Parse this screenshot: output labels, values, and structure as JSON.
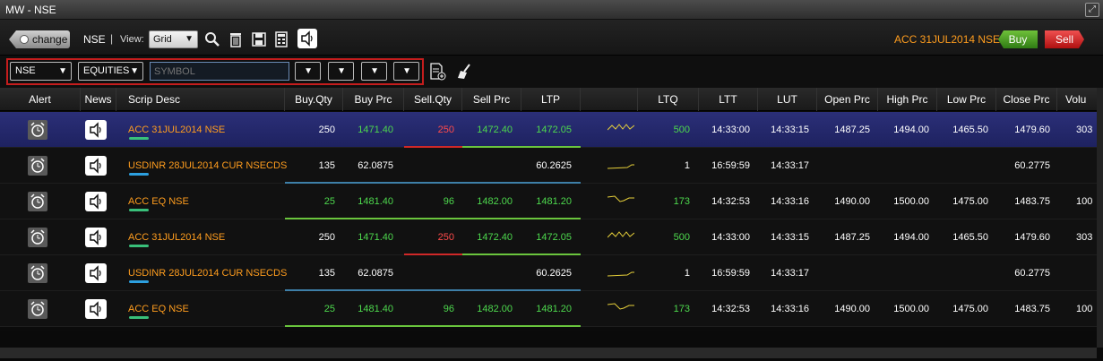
{
  "window": {
    "title": "MW - NSE"
  },
  "toolbar": {
    "change_label": "change",
    "exchange": "NSE",
    "separator": "|",
    "view_label": "View:",
    "view_value": "Grid",
    "selected_scrip": "ACC 31JUL2014 NSE",
    "buy_label": "Buy",
    "sell_label": "Sell"
  },
  "filters": {
    "exchange": "NSE",
    "segment": "EQUITIES",
    "symbol_placeholder": "SYMBOL"
  },
  "columns": [
    "Alert",
    "News",
    "Scrip Desc",
    "Buy.Qty",
    "Buy Prc",
    "Sell.Qty",
    "Sell Prc",
    "LTP",
    "",
    "LTQ",
    "LTT",
    "LUT",
    "Open Prc",
    "High Prc",
    "Low Prc",
    "Close Prc",
    "Volu"
  ],
  "rows": [
    {
      "scrip": "ACC 31JUL2014 NSE",
      "buy_qty": "250",
      "buy_prc": "1471.40",
      "sell_qty": "250",
      "sell_prc": "1472.40",
      "ltp": "1472.05",
      "ltq": "500",
      "ltt": "14:33:00",
      "lut": "14:33:15",
      "open": "1487.25",
      "high": "1494.00",
      "low": "1465.50",
      "close": "1479.60",
      "vol": "303"
    },
    {
      "scrip": "USDINR 28JUL2014 CUR NSECDS",
      "buy_qty": "135",
      "buy_prc": "62.0875",
      "sell_qty": "",
      "sell_prc": "",
      "ltp": "60.2625",
      "ltq": "1",
      "ltt": "16:59:59",
      "lut": "14:33:17",
      "open": "",
      "high": "",
      "low": "",
      "close": "60.2775",
      "vol": ""
    },
    {
      "scrip": "ACC EQ NSE",
      "buy_qty": "25",
      "buy_prc": "1481.40",
      "sell_qty": "96",
      "sell_prc": "1482.00",
      "ltp": "1481.20",
      "ltq": "173",
      "ltt": "14:32:53",
      "lut": "14:33:16",
      "open": "1490.00",
      "high": "1500.00",
      "low": "1475.00",
      "close": "1483.75",
      "vol": "100"
    },
    {
      "scrip": "ACC 31JUL2014 NSE",
      "buy_qty": "250",
      "buy_prc": "1471.40",
      "sell_qty": "250",
      "sell_prc": "1472.40",
      "ltp": "1472.05",
      "ltq": "500",
      "ltt": "14:33:00",
      "lut": "14:33:15",
      "open": "1487.25",
      "high": "1494.00",
      "low": "1465.50",
      "close": "1479.60",
      "vol": "303"
    },
    {
      "scrip": "USDINR 28JUL2014 CUR NSECDS",
      "buy_qty": "135",
      "buy_prc": "62.0875",
      "sell_qty": "",
      "sell_prc": "",
      "ltp": "60.2625",
      "ltq": "1",
      "ltt": "16:59:59",
      "lut": "14:33:17",
      "open": "",
      "high": "",
      "low": "",
      "close": "60.2775",
      "vol": ""
    },
    {
      "scrip": "ACC EQ NSE",
      "buy_qty": "25",
      "buy_prc": "1481.40",
      "sell_qty": "96",
      "sell_prc": "1482.00",
      "ltp": "1481.20",
      "ltq": "173",
      "ltt": "14:32:53",
      "lut": "14:33:16",
      "open": "1490.00",
      "high": "1500.00",
      "low": "1475.00",
      "close": "1483.75",
      "vol": "100"
    }
  ],
  "colors": {
    "accent": "#ff9d1e",
    "up": "#4dd84d",
    "down": "#ff4a4a",
    "highlight": "#c51d1d"
  }
}
